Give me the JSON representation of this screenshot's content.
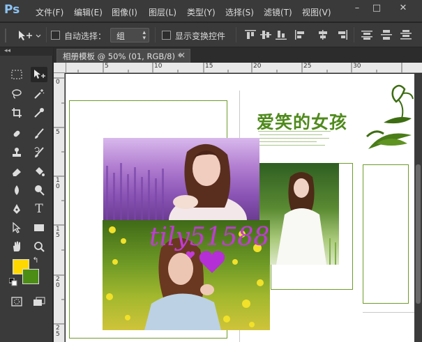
{
  "app": {
    "logo": "Ps",
    "menus": [
      "文件(F)",
      "编辑(E)",
      "图像(I)",
      "图层(L)",
      "类型(Y)",
      "选择(S)",
      "滤镜(T)",
      "视图(V)"
    ],
    "window_controls": [
      "–",
      "□",
      "✕"
    ]
  },
  "options_bar": {
    "auto_select_label": "自动选择：",
    "auto_select_value": "组",
    "show_transform_label": "显示变换控件"
  },
  "tool_panel": {
    "collapse_label": "◂◂",
    "foreground_color": "#ffd800",
    "background_color": "#4c8d16"
  },
  "document": {
    "tab_title": "相册模板 @ 50% (01, RGB/8) *",
    "tab_close": "×",
    "title_text": "爱笑的女孩",
    "watermark_text": "tily51588"
  },
  "ruler": {
    "h_numbers": [
      "5",
      "10",
      "15",
      "20",
      "25",
      "30"
    ],
    "v_numbers": [
      "0",
      "5",
      "1\n0",
      "1\n5",
      "2\n0",
      "2\n5"
    ]
  },
  "colors": {
    "accent_green": "#4f8a1c",
    "frame_green": "#6f9a2a",
    "chrome_dark": "#3a3a3a"
  }
}
